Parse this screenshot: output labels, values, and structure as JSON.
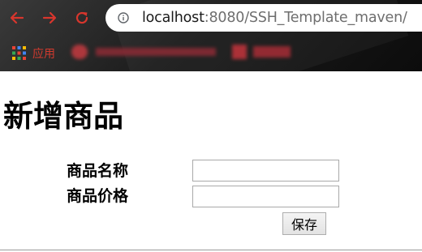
{
  "browser": {
    "url_host": "localhost",
    "url_rest": ":8080/SSH_Template_maven/",
    "bookmarks": {
      "apps_label": "应用"
    },
    "icons": {
      "back": "back-arrow-icon",
      "forward": "forward-arrow-icon",
      "reload": "reload-icon",
      "info": "info-icon",
      "apps": "apps-grid-icon"
    },
    "accent_color": "#d8362d"
  },
  "page": {
    "title": "新增商品",
    "form": {
      "name_label": "商品名称",
      "name_value": "",
      "price_label": "商品价格",
      "price_value": "",
      "save_label": "保存"
    }
  }
}
